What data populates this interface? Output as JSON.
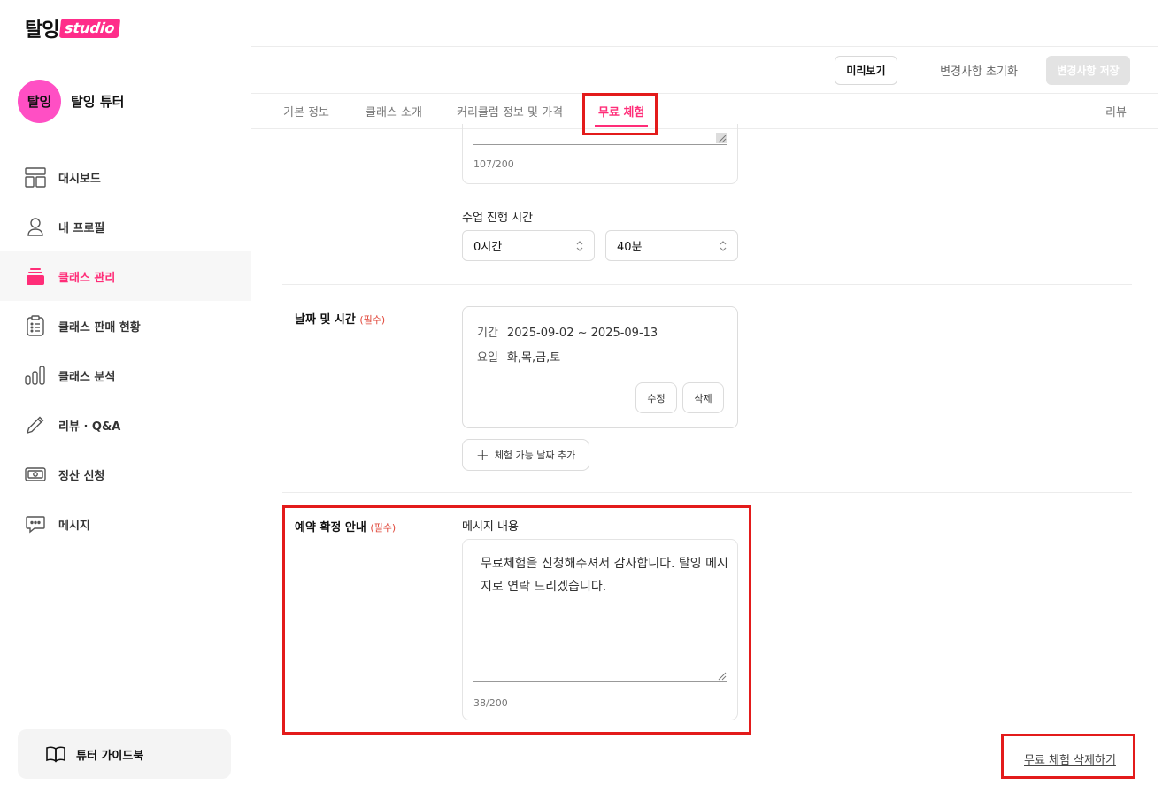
{
  "brand": {
    "logo_main": "탈잉",
    "logo_studio": "studio"
  },
  "profile": {
    "avatar_text": "탈잉",
    "name": "탈잉 튜터"
  },
  "sidebar": {
    "items": [
      {
        "label": "대시보드",
        "icon": "dashboard-icon"
      },
      {
        "label": "내 프로필",
        "icon": "user-icon"
      },
      {
        "label": "클래스 관리",
        "icon": "class-stack-icon",
        "active": true
      },
      {
        "label": "클래스 판매 현황",
        "icon": "clipboard-icon"
      },
      {
        "label": "클래스 분석",
        "icon": "bar-chart-icon"
      },
      {
        "label": "리뷰 · Q&A",
        "icon": "pencil-icon"
      },
      {
        "label": "정산 신청",
        "icon": "money-icon"
      },
      {
        "label": "메시지",
        "icon": "chat-icon"
      }
    ],
    "guide_label": "튜터 가이드북"
  },
  "header": {
    "preview_label": "미리보기",
    "reset_label": "변경사항 초기화",
    "save_label": "변경사항 저장"
  },
  "tabs": [
    {
      "label": "기본 정보"
    },
    {
      "label": "클래스 소개"
    },
    {
      "label": "커리큘럼 정보 및 가격"
    },
    {
      "label": "무료 체험",
      "active": true
    },
    {
      "label": "리뷰"
    }
  ],
  "intro": {
    "counter": "107/200"
  },
  "duration": {
    "label": "수업 진행 시간",
    "hours": "0시간",
    "minutes": "40분"
  },
  "schedule": {
    "label": "날짜 및 시간",
    "required": "(필수)",
    "period_key": "기간",
    "period_value": "2025-09-02 ~ 2025-09-13",
    "days_key": "요일",
    "days_value": "화,목,금,토",
    "edit_label": "수정",
    "delete_label": "삭제",
    "add_label": "체험 가능 날짜 추가"
  },
  "confirm": {
    "label": "예약 확정 안내",
    "required": "(필수)",
    "message_label": "메시지 내용",
    "message": "무료체험을 신청해주셔서 감사합니다. 탈잉 메시지로 연락 드리겠습니다.",
    "counter": "38/200"
  },
  "delete_trial_label": "무료 체험 삭제하기",
  "colors": {
    "accent": "#ff2d78",
    "highlight": "#e31b1b",
    "avatar": "#ff4fc4"
  }
}
